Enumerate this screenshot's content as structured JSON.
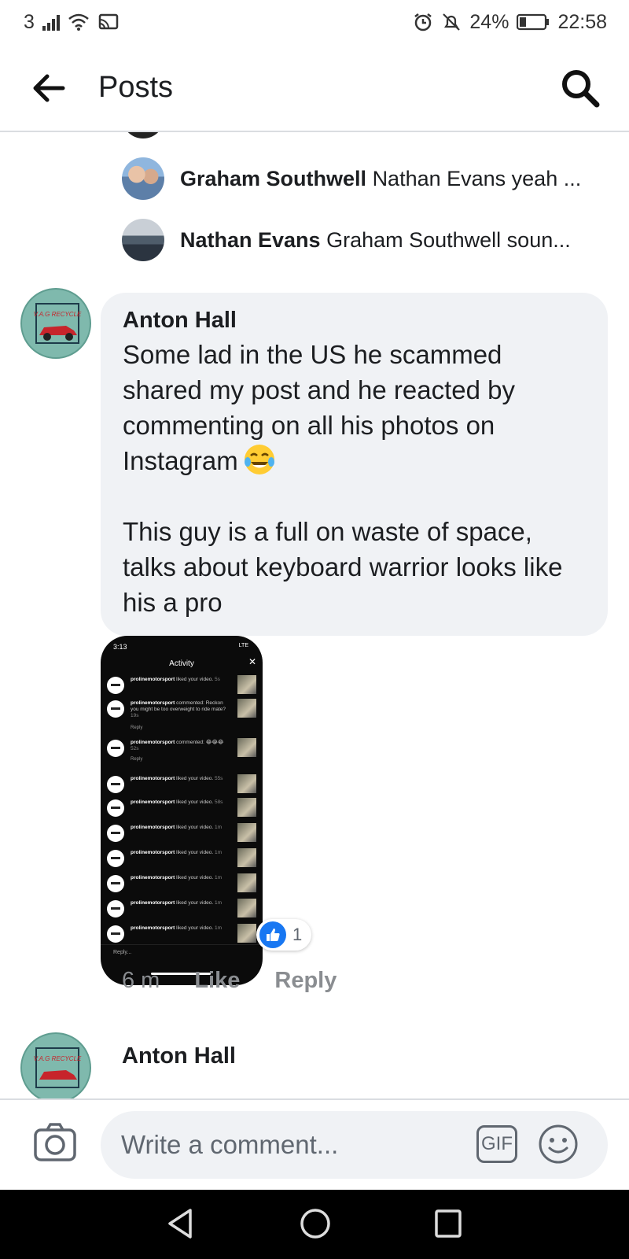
{
  "status_bar": {
    "carrier": "3",
    "battery": "24%",
    "time": "22:58",
    "icons": [
      "signal-icon",
      "wifi-icon",
      "cast-icon",
      "alarm-icon",
      "mute-icon",
      "battery-icon"
    ]
  },
  "header": {
    "title": "Posts",
    "back_icon": "arrow-left-icon",
    "search_icon": "search-icon"
  },
  "replies": [
    {
      "name": "Graham Southwell",
      "snippet": "Nathan Evans yeah ..."
    },
    {
      "name": "Nathan Evans",
      "snippet": "Graham Southwell soun..."
    }
  ],
  "comment": {
    "author": "Anton Hall",
    "text": "Some lad in the US he scammed shared my post and he reacted by commenting on all his photos on Instagram",
    "emoji": "tears-of-joy",
    "text2": "This guy is a full on waste of space, talks about keyboard warrior looks like his a pro",
    "avatar_label": "V.A.G RECYCLE",
    "reaction_count": "1",
    "time": "6 m",
    "like_label": "Like",
    "reply_label": "Reply"
  },
  "attachment": {
    "status_time": "3:13",
    "status_right": "LTE",
    "title": "Activity",
    "rows": [
      {
        "user": "prolinemotorsport",
        "action": "liked your video.",
        "age": "5s"
      },
      {
        "user": "prolinemotorsport",
        "action": "commented: Reckon you might be too overweight to ride mate?",
        "age": "19s",
        "reply": "Reply"
      },
      {
        "user": "prolinemotorsport",
        "action": "commented: 😂😂😂",
        "age": "52s",
        "reply": "Reply"
      },
      {
        "user": "prolinemotorsport",
        "action": "liked your video.",
        "age": "55s"
      },
      {
        "user": "prolinemotorsport",
        "action": "liked your video.",
        "age": "58s"
      },
      {
        "user": "prolinemotorsport",
        "action": "liked your video.",
        "age": "1m"
      },
      {
        "user": "prolinemotorsport",
        "action": "liked your video.",
        "age": "1m"
      },
      {
        "user": "prolinemotorsport",
        "action": "liked your video.",
        "age": "1m"
      },
      {
        "user": "prolinemotorsport",
        "action": "liked your video.",
        "age": "1m"
      },
      {
        "user": "prolinemotorsport",
        "action": "liked your video.",
        "age": "1m"
      }
    ],
    "bottom_reply": "Reply..."
  },
  "next_comment": {
    "author": "Anton Hall"
  },
  "composer": {
    "placeholder": "Write a comment...",
    "gif_label": "GIF",
    "camera_icon": "camera-icon",
    "emoji_icon": "smiley-icon"
  },
  "colors": {
    "bubble": "#f0f2f5",
    "like_blue": "#1877f2",
    "meta_gray": "#8a8d91",
    "avatar_teal": "#7fb9ad"
  }
}
